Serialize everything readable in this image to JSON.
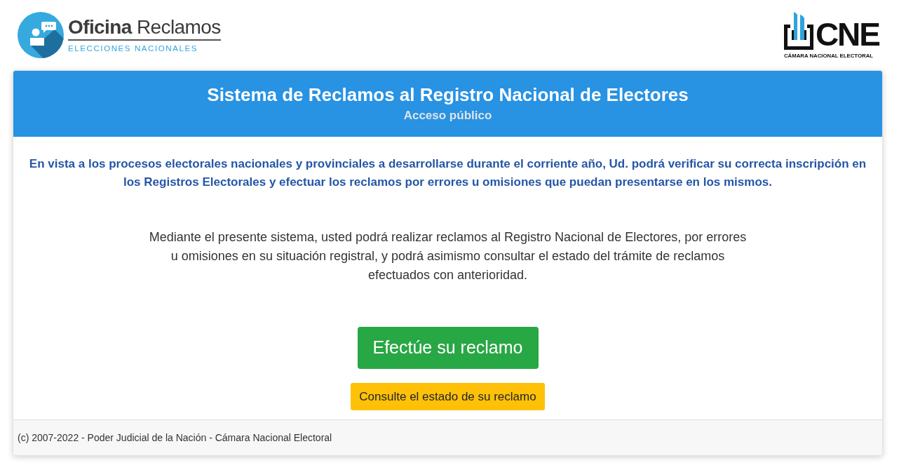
{
  "header": {
    "logo": {
      "title": "**Oficina** Reclamos",
      "subtitle": "ELECCIONES NACIONALES"
    },
    "partner_logo": {
      "title": "CNE",
      "subtitle": "CÁMARA NACIONAL ELECTORAL"
    }
  },
  "card": {
    "title": "Sistema de Reclamos al Registro Nacional de Electores",
    "subtitle": "Acceso público",
    "notice": "En vista a los procesos electorales nacionales y provinciales a desarrollarse durante el corriente año, Ud. podrá verificar su correcta inscripción en los Registros Electorales y efectuar los reclamos por errores u omisiones que puedan presentarse en los mismos.",
    "description": "Mediante el presente sistema, usted podrá realizar reclamos al Registro Nacional de Electores, por errores u omisiones en su situación registral, y podrá asimismo consultar el estado del trámite de reclamos efectuados con anterioridad.",
    "buttons": [
      {
        "label": "Efectúe su reclamo",
        "kind": "success"
      },
      {
        "label": "Consulte el estado de su reclamo",
        "kind": "warning"
      }
    ],
    "footer": "(c) 2007-2022 - Poder Judicial de la Nación - Cámara Nacional Electoral"
  }
}
